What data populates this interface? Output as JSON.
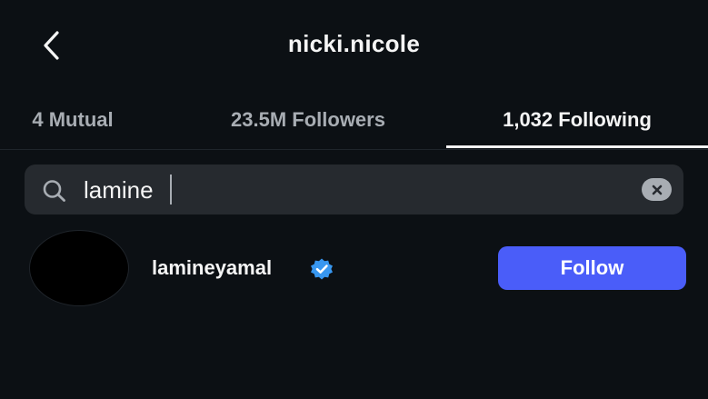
{
  "header": {
    "title": "nicki.nicole",
    "back_icon": "chevron-left-icon"
  },
  "tabs": [
    {
      "label": "4 Mutual",
      "active": false
    },
    {
      "label": "23.5M Followers",
      "active": false
    },
    {
      "label": "1,032 Following",
      "active": true
    }
  ],
  "search": {
    "value": "lamine",
    "icon": "search-icon",
    "clear_icon": "clear-icon"
  },
  "results": [
    {
      "username": "lamineyamal",
      "verified": true,
      "button_label": "Follow"
    }
  ],
  "colors": {
    "background": "#0c1014",
    "search_bg": "#262a2f",
    "follow_button": "#4a5df9",
    "verified_badge": "#3897f0",
    "inactive_tab_text": "#a8adb3"
  }
}
